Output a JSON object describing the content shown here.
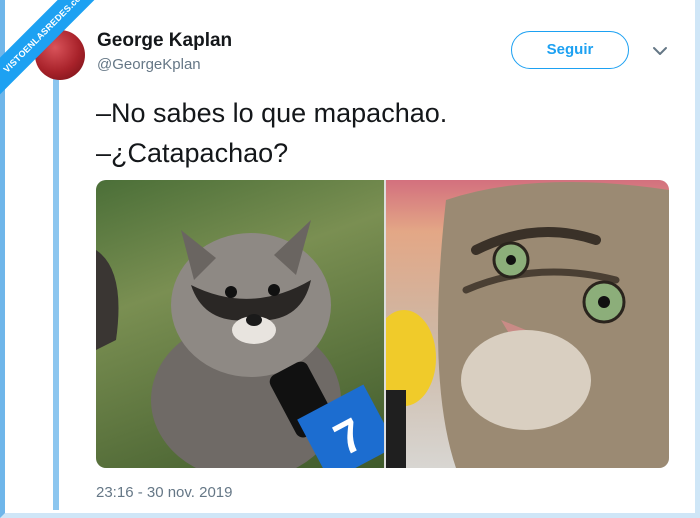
{
  "watermark": {
    "text": "VISTOENLASREDES",
    "sub": ".com"
  },
  "tweet": {
    "author": {
      "name": "George Kaplan",
      "handle": "@GeorgeKplan"
    },
    "follow_label": "Seguir",
    "lines": [
      "–No sabes lo que mapachao.",
      "–¿Catapachao?"
    ],
    "timestamp": "23:16 - 30 nov. 2019"
  },
  "colors": {
    "accent": "#1da1f2",
    "text_primary": "#14171a",
    "text_secondary": "#657786"
  },
  "icons": {
    "menu": "chevron-down-icon"
  }
}
